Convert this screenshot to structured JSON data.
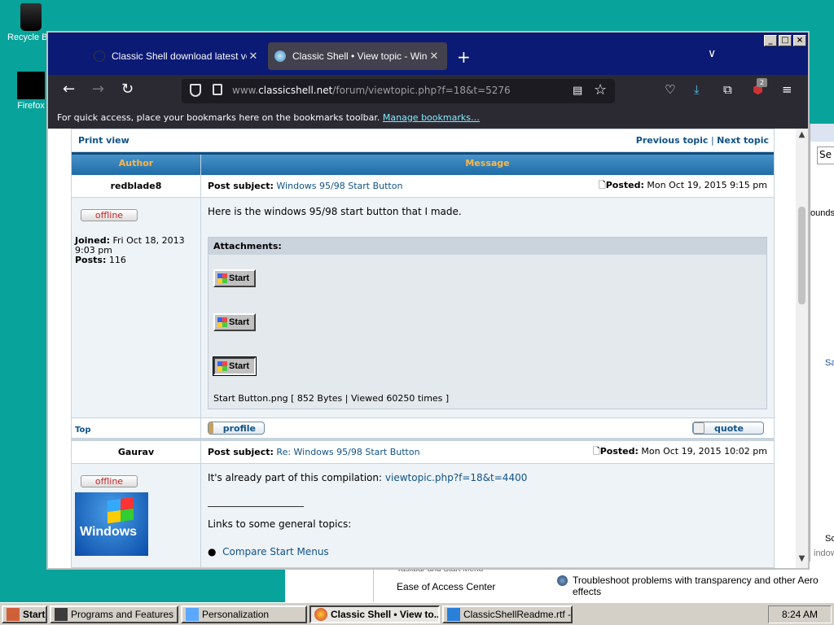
{
  "desktop": {
    "icons": [
      {
        "label": "Recycle Bin"
      },
      {
        "label": "Firefox"
      }
    ]
  },
  "bg_window": {
    "cut_text": "Taskbar and Start Menu",
    "ease": "Ease of Access Center",
    "troubleshoot": "Troubleshoot problems with transparency and other Aero effects",
    "right_panel": {
      "se": "Se",
      "ounds": "ounds",
      "sa": "Sa",
      "sc": "Sc",
      "indow": "indow"
    }
  },
  "browser": {
    "window_controls": [
      "_",
      "□",
      "×"
    ],
    "tabs": [
      {
        "title": "Classic Shell download latest version",
        "active": false
      },
      {
        "title": "Classic Shell • View topic - Windows",
        "active": true
      }
    ],
    "new_tab": "+",
    "tab_list": "∨",
    "nav": {
      "back": "←",
      "forward": "→",
      "reload": "↻"
    },
    "url_prefix": "www.",
    "url_domain": "classicshell.net",
    "url_path": "/forum/viewtopic.php?f=18&t=5276",
    "toolbar_icons": [
      "pocket-icon",
      "download-icon",
      "extensions-icon",
      "ublock-icon",
      "menu-icon"
    ],
    "ublock_badge": "2",
    "bookmarks_text": "For quick access, place your bookmarks here on the bookmarks toolbar.",
    "bookmarks_link": "Manage bookmarks…"
  },
  "forum": {
    "print_view": "Print view",
    "prev_topic": "Previous topic",
    "separator": "|",
    "next_topic": "Next topic",
    "col_author": "Author",
    "col_message": "Message",
    "posts": [
      {
        "author": "redblade8",
        "subject_label": "Post subject:",
        "subject": "Windows 95/98 Start Button",
        "posted_label": "Posted:",
        "posted": "Mon Oct 19, 2015 9:15 pm",
        "status": "offline",
        "joined_label": "Joined:",
        "joined": "Fri Oct 18, 2013 9:03 pm",
        "posts_label": "Posts:",
        "posts": "116",
        "message": "Here is the windows 95/98 start button that I made.",
        "attachments_label": "Attachments:",
        "start_label": "Start",
        "attachment_file": "Start Button.png [ 852 Bytes | Viewed 60250 times ]"
      },
      {
        "author": "Gaurav",
        "subject_label": "Post subject:",
        "subject": "Re: Windows 95/98 Start Button",
        "posted_label": "Posted:",
        "posted": "Mon Oct 19, 2015 10:02 pm",
        "status": "offline",
        "avatar_text": "Windows",
        "message_prefix": "It's already part of this compilation:",
        "message_link": "viewtopic.php?f=18&t=4400",
        "links_heading": "Links to some general topics:",
        "bullet_link": "Compare Start Menus"
      }
    ],
    "top_link": "Top",
    "profile_btn": "profile",
    "quote_btn": "quote"
  },
  "taskbar": {
    "start": "Start",
    "items": [
      {
        "label": "Programs and Features"
      },
      {
        "label": "Personalization"
      },
      {
        "label": "Classic Shell • View to..."
      },
      {
        "label": "ClassicShellReadme.rtf - ..."
      }
    ],
    "clock": "8:24 AM"
  }
}
